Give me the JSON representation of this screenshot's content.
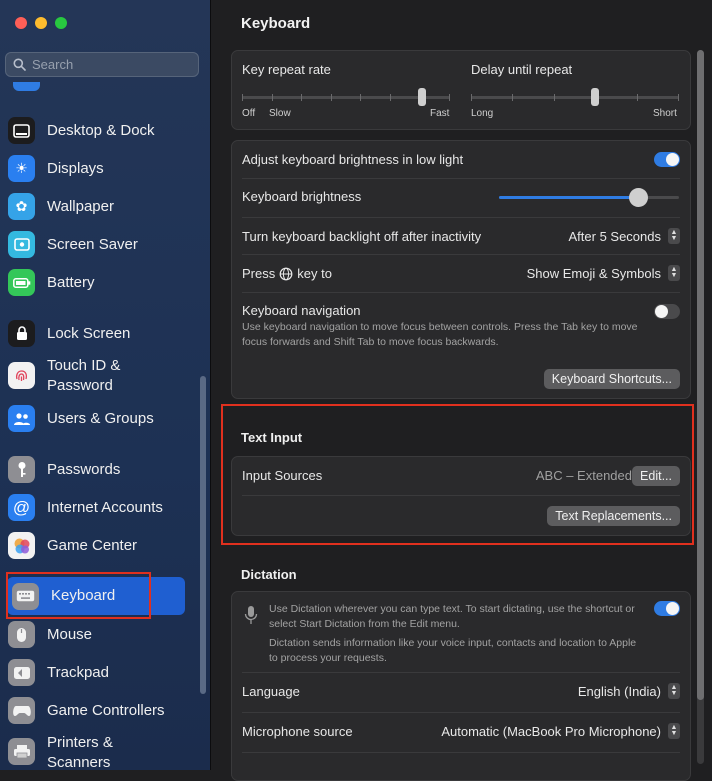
{
  "colors": {
    "accent": "#1f5fd1",
    "highlight_red": "#e0301e",
    "toggle_on": "#2f7ce3"
  },
  "window": {
    "title": "Keyboard"
  },
  "search": {
    "placeholder": "Search"
  },
  "sidebar": {
    "items": [
      {
        "label": "Desktop & Dock",
        "icon": "desktop-dock-icon"
      },
      {
        "label": "Displays",
        "icon": "displays-icon"
      },
      {
        "label": "Wallpaper",
        "icon": "wallpaper-icon"
      },
      {
        "label": "Screen Saver",
        "icon": "screen-saver-icon"
      },
      {
        "label": "Battery",
        "icon": "battery-icon"
      },
      {
        "label": "Lock Screen",
        "icon": "lock-screen-icon"
      },
      {
        "label": "Touch ID &",
        "label2": "Password",
        "icon": "fingerprint-icon"
      },
      {
        "label": "Users & Groups",
        "icon": "users-groups-icon"
      },
      {
        "label": "Passwords",
        "icon": "key-icon"
      },
      {
        "label": "Internet Accounts",
        "icon": "at-icon"
      },
      {
        "label": "Game Center",
        "icon": "game-center-icon"
      },
      {
        "label": "Keyboard",
        "icon": "keyboard-icon",
        "selected": true
      },
      {
        "label": "Mouse",
        "icon": "mouse-icon"
      },
      {
        "label": "Trackpad",
        "icon": "trackpad-icon"
      },
      {
        "label": "Game Controllers",
        "icon": "gamepad-icon"
      },
      {
        "label": "Printers &",
        "label2": "Scanners",
        "icon": "printer-icon"
      }
    ]
  },
  "repeat": {
    "rate_label": "Key repeat rate",
    "rate_min": "Off",
    "rate_slow": "Slow",
    "rate_max": "Fast",
    "rate_value": 0.88,
    "delay_label": "Delay until repeat",
    "delay_min": "Long",
    "delay_max": "Short",
    "delay_value": 0.6
  },
  "brightness": {
    "adjust_label": "Adjust keyboard brightness in low light",
    "adjust_on": true,
    "label": "Keyboard brightness",
    "value": 0.78,
    "backlight_label": "Turn keyboard backlight off after inactivity",
    "backlight_value": "After 5 Seconds",
    "press_label_pre": "Press",
    "press_label_post": "key to",
    "press_value": "Show Emoji & Symbols",
    "nav_label": "Keyboard navigation",
    "nav_hint": "Use keyboard navigation to move focus between controls. Press the Tab key to move focus forwards and Shift Tab to move focus backwards.",
    "nav_on": false,
    "shortcuts_button": "Keyboard Shortcuts..."
  },
  "text_input": {
    "title": "Text Input",
    "sources_label": "Input Sources",
    "sources_value": "ABC – Extended",
    "edit_button": "Edit...",
    "replacements_button": "Text Replacements..."
  },
  "dictation": {
    "title": "Dictation",
    "hint1": "Use Dictation wherever you can type text. To start dictating, use the shortcut or select Start Dictation from the Edit menu.",
    "hint2": "Dictation sends information like your voice input, contacts and location to Apple to process your requests.",
    "enabled": true,
    "language_label": "Language",
    "language_value": "English (India)",
    "mic_label": "Microphone source",
    "mic_value": "Automatic (MacBook Pro Microphone)"
  }
}
